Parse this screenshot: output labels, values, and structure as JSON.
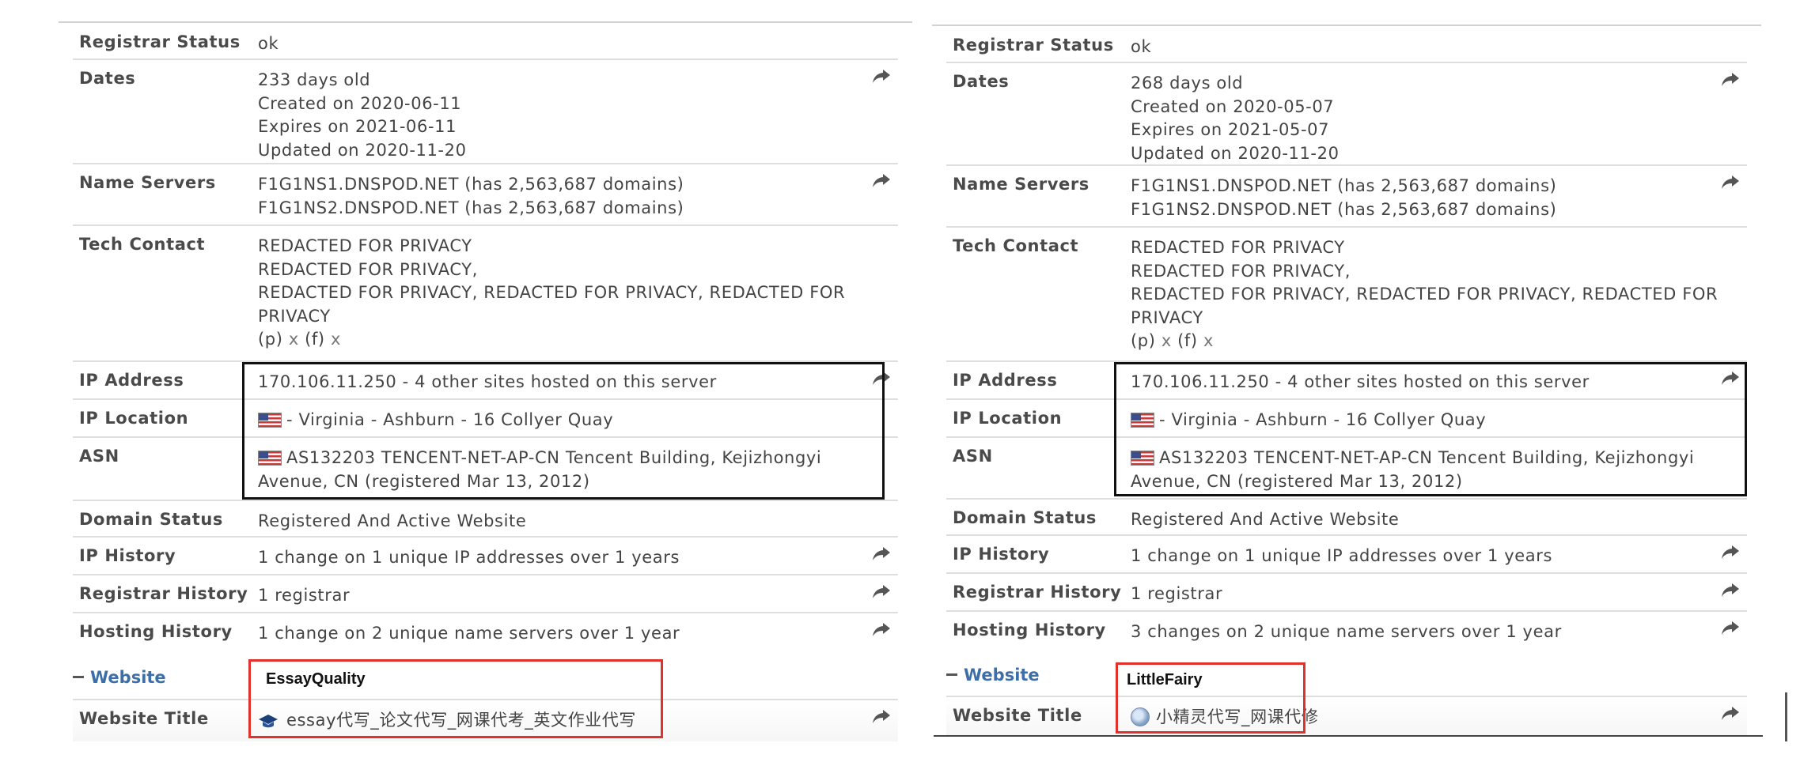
{
  "left": {
    "registrar_status": {
      "label": "Registrar Status",
      "value": "ok"
    },
    "dates": {
      "label": "Dates",
      "lines": [
        "233 days old",
        "Created on 2020-06-11",
        "Expires on 2021-06-11",
        "Updated on 2020-11-20"
      ]
    },
    "name_servers": {
      "label": "Name Servers",
      "lines": [
        "F1G1NS1.DNSPOD.NET (has 2,563,687 domains)",
        "F1G1NS2.DNSPOD.NET (has 2,563,687 domains)"
      ]
    },
    "tech_contact": {
      "label": "Tech Contact",
      "line1": "REDACTED FOR PRIVACY",
      "line2": "REDACTED FOR PRIVACY,",
      "line3": "REDACTED FOR PRIVACY, REDACTED FOR PRIVACY, REDACTED FOR PRIVACY",
      "phone_label": "(p)",
      "phone_value": "x",
      "fax_label": "(f)",
      "fax_value": "x"
    },
    "ip_address": {
      "label": "IP Address",
      "value": "170.106.11.250 - 4 other sites hosted on this server"
    },
    "ip_location": {
      "label": "IP Location",
      "value": "- Virginia - Ashburn - 16 Collyer Quay"
    },
    "asn": {
      "label": "ASN",
      "value": "AS132203 TENCENT-NET-AP-CN Tencent Building, Kejizhongyi Avenue, CN (registered Mar 13, 2012)"
    },
    "domain_status": {
      "label": "Domain Status",
      "value": "Registered And Active Website"
    },
    "ip_history": {
      "label": "IP History",
      "value": "1 change on 1 unique IP addresses over 1 years"
    },
    "registrar_history": {
      "label": "Registrar History",
      "value": "1 registrar"
    },
    "hosting_history": {
      "label": "Hosting History",
      "value": "1 change on 2 unique name servers over 1 year"
    },
    "website_section": {
      "label": "Website"
    },
    "annotation": "EssayQuality",
    "website_title": {
      "label": "Website Title",
      "value": "essay代写_论文代写_网课代考_英文作业代写"
    }
  },
  "right": {
    "registrar_status": {
      "label": "Registrar Status",
      "value": "ok"
    },
    "dates": {
      "label": "Dates",
      "lines": [
        "268 days old",
        "Created on 2020-05-07",
        "Expires on 2021-05-07",
        "Updated on 2020-11-20"
      ]
    },
    "name_servers": {
      "label": "Name Servers",
      "lines": [
        "F1G1NS1.DNSPOD.NET (has 2,563,687 domains)",
        "F1G1NS2.DNSPOD.NET (has 2,563,687 domains)"
      ]
    },
    "tech_contact": {
      "label": "Tech Contact",
      "line1": "REDACTED FOR PRIVACY",
      "line2": "REDACTED FOR PRIVACY,",
      "line3": "REDACTED FOR PRIVACY, REDACTED FOR PRIVACY, REDACTED FOR PRIVACY",
      "phone_label": "(p)",
      "phone_value": "x",
      "fax_label": "(f)",
      "fax_value": "x"
    },
    "ip_address": {
      "label": "IP Address",
      "value": "170.106.11.250 - 4 other sites hosted on this server"
    },
    "ip_location": {
      "label": "IP Location",
      "value": "- Virginia - Ashburn - 16 Collyer Quay"
    },
    "asn": {
      "label": "ASN",
      "value": "AS132203 TENCENT-NET-AP-CN Tencent Building, Kejizhongyi Avenue, CN (registered Mar 13, 2012)"
    },
    "domain_status": {
      "label": "Domain Status",
      "value": "Registered And Active Website"
    },
    "ip_history": {
      "label": "IP History",
      "value": "1 change on 1 unique IP addresses over 1 years"
    },
    "registrar_history": {
      "label": "Registrar History",
      "value": "1 registrar"
    },
    "hosting_history": {
      "label": "Hosting History",
      "value": "3 changes on 2 unique name servers over 1 year"
    },
    "website_section": {
      "label": "Website"
    },
    "annotation": "LittleFairy",
    "website_title": {
      "label": "Website Title",
      "value": "小精灵代写_网课代修"
    }
  },
  "colors": {
    "highlight_box": "#111111",
    "annotation_box": "#e0322a",
    "section_link": "#3d6ea8"
  },
  "icons": [
    "share-arrow-icon",
    "us-flag-icon",
    "graduation-cap-icon",
    "globe-icon"
  ]
}
